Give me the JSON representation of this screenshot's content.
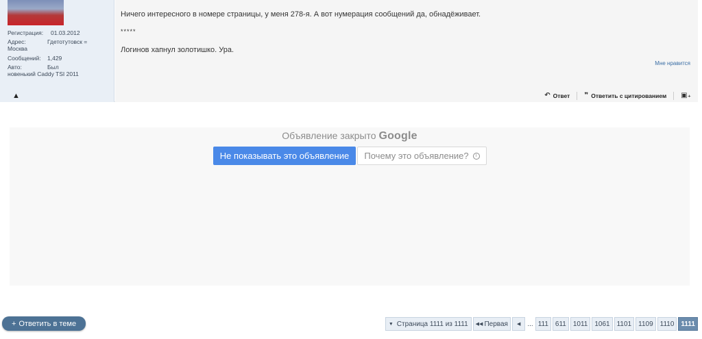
{
  "user": {
    "reg_label": "Регистрация:",
    "reg_value": "01.03.2012",
    "addr_label": "Адрес:",
    "addr_value": "Гдетотутовск =",
    "addr_value2": "Москва",
    "posts_label": "Сообщений:",
    "posts_value": "1,429",
    "car_label": "Авто:",
    "car_value": "Был",
    "car_value2": "новенький Caddy TSI 2011"
  },
  "post": {
    "line1": "Ничего интересного в номере страницы, у меня 278-я. А вот нумерация сообщений да, обнадёживает.",
    "line2": "*****",
    "line3": "Логинов хапнул золотишко. Ура.",
    "like": "Мне нравится",
    "reply": "Ответ",
    "quote_reply": "Ответить с цитированием"
  },
  "ad": {
    "closed_text": "Объявление закрыто",
    "brand": "Google",
    "hide_button": "Не показывать это объявление",
    "why_button": "Почему это объявление?"
  },
  "reply_thread": "Ответить в теме",
  "pagination": {
    "page_of": "Страница 1111 из 1111",
    "first": "Первая",
    "dots": "...",
    "pages": [
      "111",
      "611",
      "1011",
      "1061",
      "1101",
      "1109",
      "1110"
    ],
    "current": "1111"
  }
}
